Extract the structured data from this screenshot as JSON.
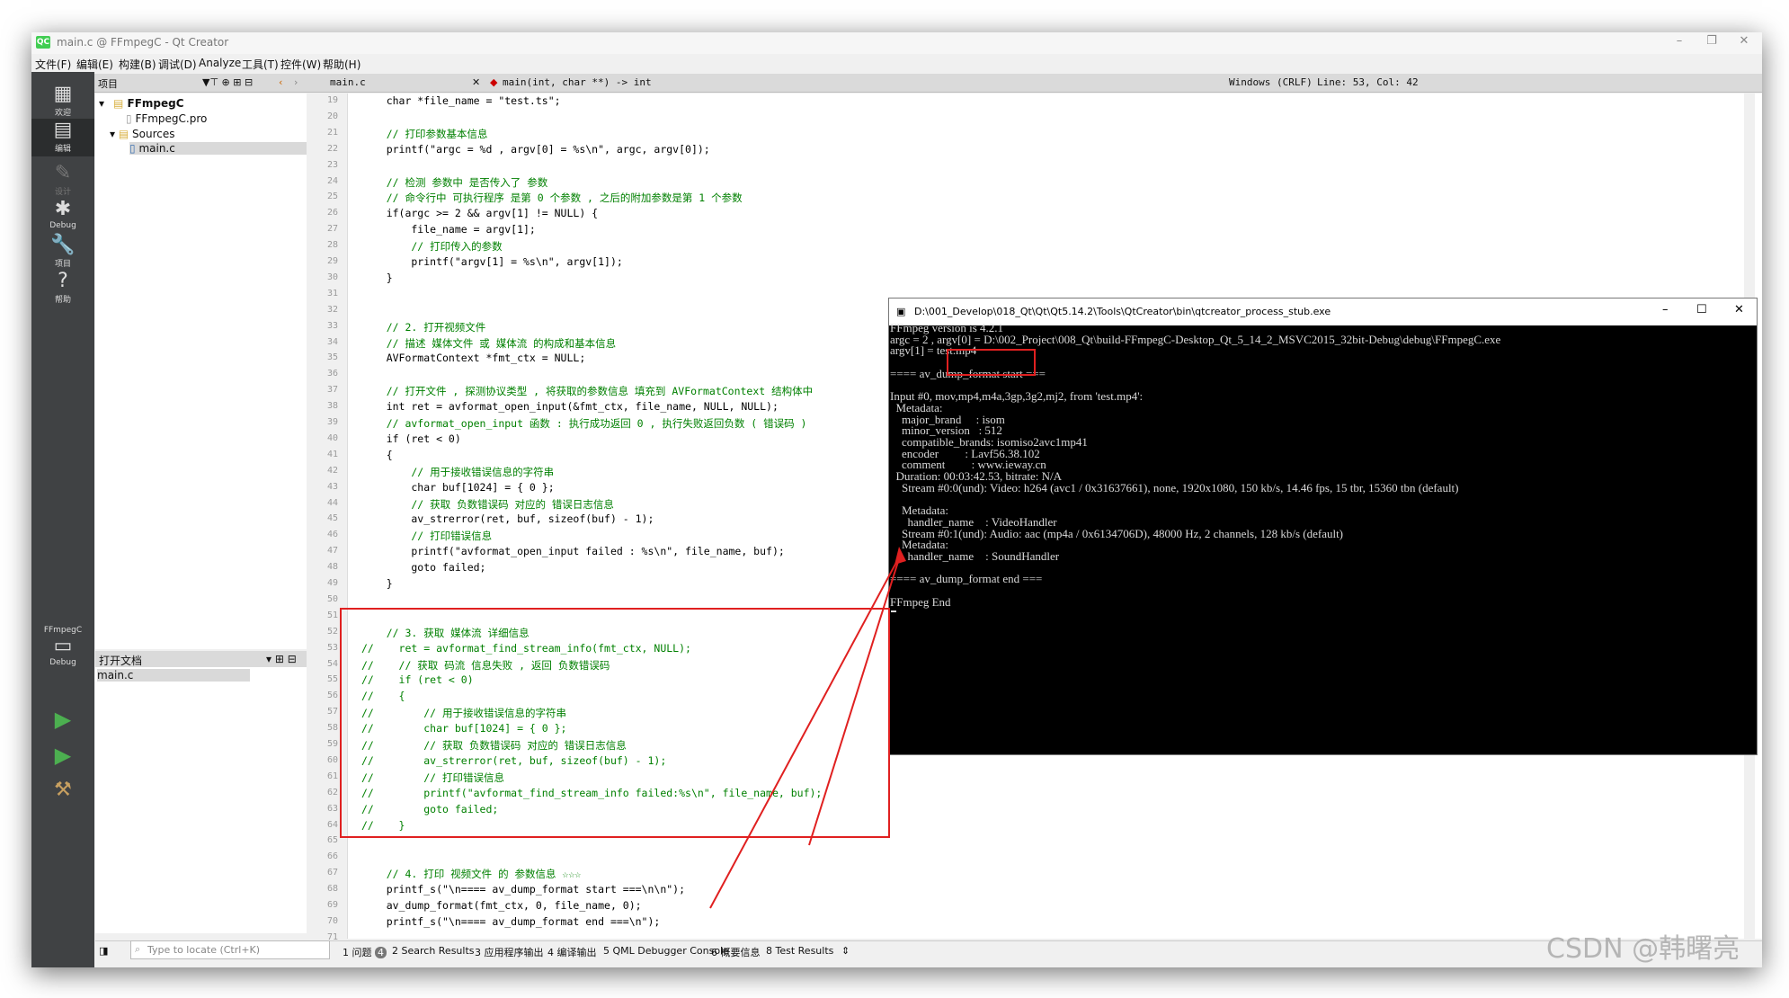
{
  "window": {
    "title": "main.c @ FFmpegC - Qt Creator",
    "logo": "QC"
  },
  "menu": [
    "文件(F)",
    "编辑(E)",
    "构建(B)",
    "调试(D)",
    "Analyze",
    "工具(T)",
    "控件(W)",
    "帮助(H)"
  ],
  "toolbar": {
    "projects": "项目",
    "file": "main.c",
    "function": "main(int, char **) -> int",
    "encoding": "Windows (CRLF)",
    "position": "Line: 53, Col: 42"
  },
  "modes": [
    {
      "label": "欢迎",
      "icon": "grid-icon"
    },
    {
      "label": "编辑",
      "icon": "edit-icon"
    },
    {
      "label": "设计",
      "icon": "pen-icon"
    },
    {
      "label": "Debug",
      "icon": "bug-icon"
    },
    {
      "label": "项目",
      "icon": "wrench-icon"
    },
    {
      "label": "帮助",
      "icon": "help-icon"
    }
  ],
  "kit": {
    "project": "FFmpegC",
    "build": "Debug"
  },
  "tree": {
    "project": "FFmpegC",
    "pro": "FFmpegC.pro",
    "sources": "Sources",
    "main": "main.c"
  },
  "open_docs": {
    "title": "打开文档",
    "items": [
      "main.c"
    ]
  },
  "bottom": {
    "locator": "Type to locate (Ctrl+K)",
    "tabs": [
      "1 问题",
      "2 Search Results",
      "3 应用程序输出",
      "4 编译输出",
      "5 QML Debugger Console",
      "6 概要信息",
      "8 Test Results"
    ],
    "issues": "4"
  },
  "code": [
    {
      "n": "19",
      "t": "    char *file_name = \"test.ts\";",
      "c": "s"
    },
    {
      "n": "20",
      "t": "",
      "c": ""
    },
    {
      "n": "21",
      "t": "    // 打印参数基本信息",
      "c": "cmt"
    },
    {
      "n": "22",
      "t": "    printf(\"argc = %d , argv[0] = %s\\n\", argc, argv[0]);",
      "c": "s"
    },
    {
      "n": "23",
      "t": "",
      "c": ""
    },
    {
      "n": "24",
      "t": "    // 检测 参数中 是否传入了 参数",
      "c": "cmt"
    },
    {
      "n": "25",
      "t": "    // 命令行中 可执行程序 是第 0 个参数 , 之后的附加参数是第 1 个参数",
      "c": "cmt"
    },
    {
      "n": "26",
      "t": "    if(argc >= 2 && argv[1] != NULL) {",
      "c": "s"
    },
    {
      "n": "27",
      "t": "        file_name = argv[1];",
      "c": "s"
    },
    {
      "n": "28",
      "t": "        // 打印传入的参数",
      "c": "cmt"
    },
    {
      "n": "29",
      "t": "        printf(\"argv[1] = %s\\n\", argv[1]);",
      "c": "s"
    },
    {
      "n": "30",
      "t": "    }",
      "c": ""
    },
    {
      "n": "31",
      "t": "",
      "c": ""
    },
    {
      "n": "32",
      "t": "",
      "c": ""
    },
    {
      "n": "33",
      "t": "    // 2. 打开视频文件",
      "c": "cmt"
    },
    {
      "n": "34",
      "t": "    // 描述 媒体文件 或 媒体流 的构成和基本信息",
      "c": "cmt"
    },
    {
      "n": "35",
      "t": "    AVFormatContext *fmt_ctx = NULL;",
      "c": "s"
    },
    {
      "n": "36",
      "t": "",
      "c": ""
    },
    {
      "n": "37",
      "t": "    // 打开文件 , 探测协议类型 , 将获取的参数信息 填充到 AVFormatContext 结构体中",
      "c": "cmt"
    },
    {
      "n": "38",
      "t": "    int ret = avformat_open_input(&fmt_ctx, file_name, NULL, NULL);",
      "c": "s"
    },
    {
      "n": "39",
      "t": "    // avformat_open_input 函数 : 执行成功返回 0 , 执行失败返回负数 ( 错误码 )",
      "c": "cmt"
    },
    {
      "n": "40",
      "t": "    if (ret < 0)",
      "c": "s"
    },
    {
      "n": "41",
      "t": "    {",
      "c": ""
    },
    {
      "n": "42",
      "t": "        // 用于接收错误信息的字符串",
      "c": "cmt"
    },
    {
      "n": "43",
      "t": "        char buf[1024] = { 0 };",
      "c": "s"
    },
    {
      "n": "44",
      "t": "        // 获取 负数错误码 对应的 错误日志信息",
      "c": "cmt"
    },
    {
      "n": "45",
      "t": "        av_strerror(ret, buf, sizeof(buf) - 1);",
      "c": "s"
    },
    {
      "n": "46",
      "t": "        // 打印错误信息",
      "c": "cmt"
    },
    {
      "n": "47",
      "t": "        printf(\"avformat_open_input failed : %s\\n\", file_name, buf);",
      "c": "s"
    },
    {
      "n": "48",
      "t": "        goto failed;",
      "c": "s"
    },
    {
      "n": "49",
      "t": "    }",
      "c": ""
    },
    {
      "n": "50",
      "t": "",
      "c": ""
    },
    {
      "n": "51",
      "t": "",
      "c": ""
    },
    {
      "n": "52",
      "t": "    // 3. 获取 媒体流 详细信息",
      "c": "cmt"
    },
    {
      "n": "53",
      "t": "//    ret = avformat_find_stream_info(fmt_ctx, NULL);",
      "c": "cmt"
    },
    {
      "n": "54",
      "t": "//    // 获取 码流 信息失败 , 返回 负数错误码",
      "c": "cmt"
    },
    {
      "n": "55",
      "t": "//    if (ret < 0)",
      "c": "cmt"
    },
    {
      "n": "56",
      "t": "//    {",
      "c": "cmt"
    },
    {
      "n": "57",
      "t": "//        // 用于接收错误信息的字符串",
      "c": "cmt"
    },
    {
      "n": "58",
      "t": "//        char buf[1024] = { 0 };",
      "c": "cmt"
    },
    {
      "n": "59",
      "t": "//        // 获取 负数错误码 对应的 错误日志信息",
      "c": "cmt"
    },
    {
      "n": "60",
      "t": "//        av_strerror(ret, buf, sizeof(buf) - 1);",
      "c": "cmt"
    },
    {
      "n": "61",
      "t": "//        // 打印错误信息",
      "c": "cmt"
    },
    {
      "n": "62",
      "t": "//        printf(\"avformat_find_stream_info failed:%s\\n\", file_name, buf);",
      "c": "cmt"
    },
    {
      "n": "63",
      "t": "//        goto failed;",
      "c": "cmt"
    },
    {
      "n": "64",
      "t": "//    }",
      "c": "cmt"
    },
    {
      "n": "65",
      "t": "",
      "c": ""
    },
    {
      "n": "66",
      "t": "",
      "c": ""
    },
    {
      "n": "67",
      "t": "    // 4. 打印 视频文件 的 参数信息 ☆☆☆",
      "c": "cmt"
    },
    {
      "n": "68",
      "t": "    printf_s(\"\\n==== av_dump_format start ===\\n\\n\");",
      "c": "s"
    },
    {
      "n": "69",
      "t": "    av_dump_format(fmt_ctx, 0, file_name, 0);",
      "c": "s"
    },
    {
      "n": "70",
      "t": "    printf_s(\"\\n==== av_dump_format end ===\\n\");",
      "c": "s"
    },
    {
      "n": "71",
      "t": "",
      "c": ""
    }
  ],
  "console": {
    "title": "D:\\001_Develop\\018_Qt\\Qt\\Qt5.14.2\\Tools\\QtCreator\\bin\\qtcreator_process_stub.exe",
    "lines": [
      "FFmpeg version is 4.2.1",
      "argc = 2 , argv[0] = D:\\002_Project\\008_Qt\\build-FFmpegC-Desktop_Qt_5_14_2_MSVC2015_32bit-Debug\\debug\\FFmpegC.exe",
      "argv[1] = test.mp4",
      "",
      "==== av_dump_format start ===",
      "",
      "Input #0, mov,mp4,m4a,3gp,3g2,mj2, from 'test.mp4':",
      "  Metadata:",
      "    major_brand     : isom",
      "    minor_version   : 512",
      "    compatible_brands: isomiso2avc1mp41",
      "    encoder         : Lavf56.38.102",
      "    comment         : www.ieway.cn",
      "  Duration: 00:03:42.53, bitrate: N/A",
      "    Stream #0:0(und): Video: h264 (avc1 / 0x31637661), none, 1920x1080, 150 kb/s, 14.46 fps, 15 tbr, 15360 tbn (default)",
      "",
      "    Metadata:",
      "      handler_name    : VideoHandler",
      "    Stream #0:1(und): Audio: aac (mp4a / 0x6134706D), 48000 Hz, 2 channels, 128 kb/s (default)",
      "    Metadata:",
      "      handler_name    : SoundHandler",
      "",
      "==== av_dump_format end ===",
      "",
      "FFmpeg End"
    ]
  },
  "watermark": "CSDN @韩曙亮"
}
